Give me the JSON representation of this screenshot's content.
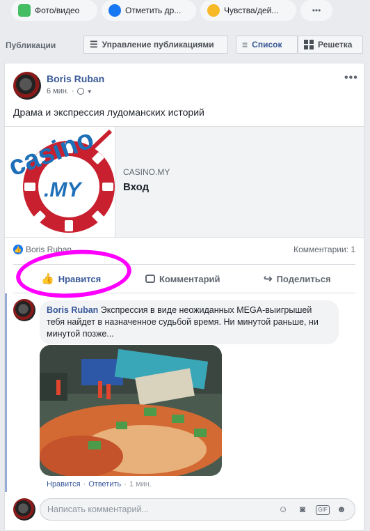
{
  "composer": {
    "items": [
      {
        "label": "Фото/видео",
        "icon": "photo-icon",
        "color": "#45bd62"
      },
      {
        "label": "Отметить др...",
        "icon": "tag-friends-icon",
        "color": "#1877f2"
      },
      {
        "label": "Чувства/дей...",
        "icon": "feeling-icon",
        "color": "#f7b928"
      },
      {
        "label": "•••",
        "icon": "more-icon"
      }
    ]
  },
  "publications": {
    "label": "Публикации",
    "manage_label": "Управление публикациями",
    "list_label": "Список",
    "grid_label": "Решетка"
  },
  "post": {
    "author": "Boris Ruban",
    "time": "6 мин.",
    "more": "•••",
    "text": "Драма и экспрессия лудоманских историй",
    "link": {
      "logo_text_top": "casino",
      "logo_text_mid": ".MY",
      "domain": "CASINO.MY",
      "title": "Вход"
    },
    "reactions_name": "Boris Ruban",
    "comments_count": "Комментарии: 1",
    "actions": {
      "like": "Нравится",
      "comment": "Комментарий",
      "share": "Поделиться"
    },
    "comment": {
      "author": "Boris Ruban",
      "text": "Экспрессия в виде неожиданных MEGA-выигрышей тебя найдет в назначенное судьбой время. Ни минутой раньше, ни минутой позже...",
      "like": "Нравится",
      "reply": "Ответить",
      "sep": "·",
      "time": "1 мин."
    },
    "write_placeholder": "Написать комментарий..."
  },
  "colors": {
    "accent": "#385898",
    "highlight": "#ff00ff",
    "background": "#e9ebee"
  }
}
